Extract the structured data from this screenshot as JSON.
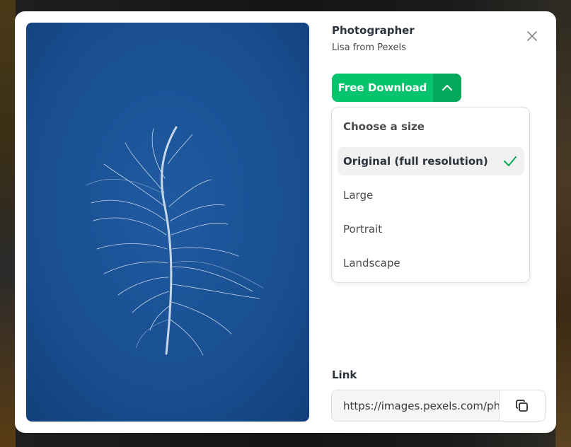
{
  "photographer": {
    "heading": "Photographer",
    "name": "Lisa from Pexels"
  },
  "download": {
    "button_label": "Free Download",
    "accent_color": "#05c46b",
    "toggle_color": "#03a85a"
  },
  "size_menu": {
    "heading": "Choose a size",
    "options": [
      {
        "label": "Original (full resolution)",
        "selected": true
      },
      {
        "label": "Large",
        "selected": false
      },
      {
        "label": "Portrait",
        "selected": false
      },
      {
        "label": "Landscape",
        "selected": false
      }
    ]
  },
  "link": {
    "label": "Link",
    "value": "https://images.pexels.com/photos/"
  },
  "icons": {
    "close": "close-icon",
    "toggle": "chevron-up-icon",
    "check": "checkmark-icon",
    "copy": "copy-icon"
  },
  "photo": {
    "subject": "white feather on blue background",
    "background_color": "#1b4f8e"
  }
}
